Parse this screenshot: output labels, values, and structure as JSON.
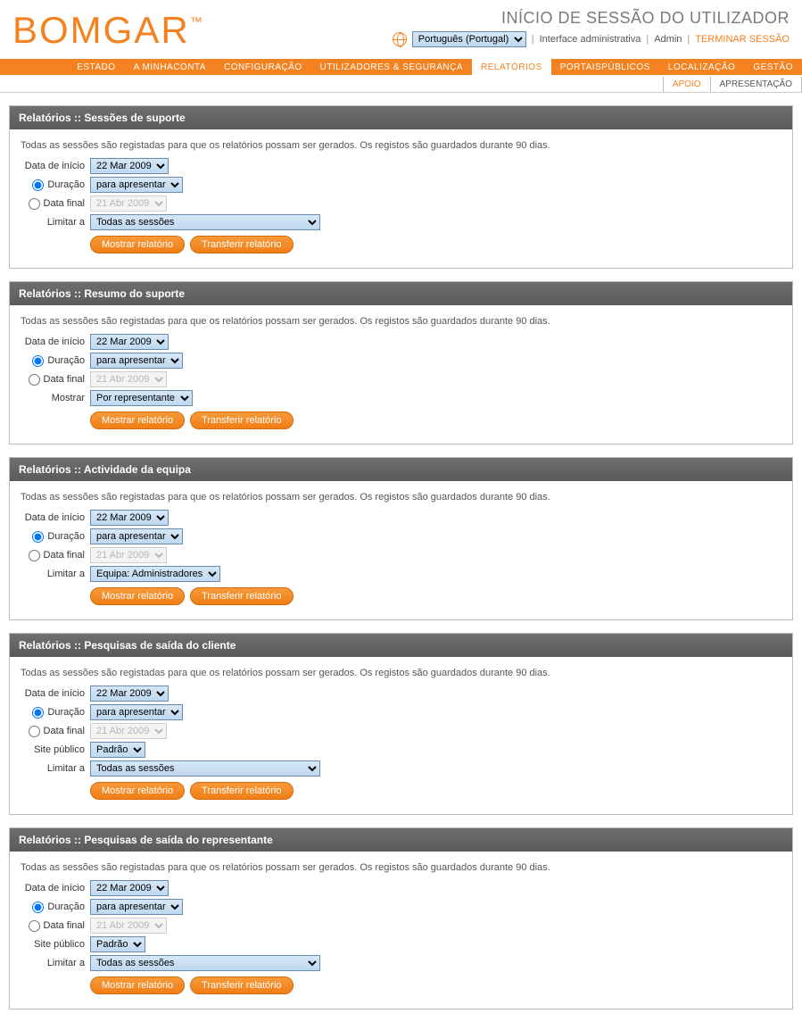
{
  "header": {
    "logo": "BOMGAR",
    "tm": "™",
    "title": "INÍCIO DE SESSÃO DO UTILIZADOR",
    "language": "Português (Portugal)",
    "admin_interface": "Interface administrativa",
    "admin": "Admin",
    "logout": "TERMINAR SESSÃO"
  },
  "nav": {
    "items": [
      "ESTADO",
      "A MINHACONTA",
      "CONFIGURAÇÃO",
      "UTILIZADORES & SEGURANÇA",
      "RELATÓRIOS",
      "PORTAISPÚBLICOS",
      "LOCALIZAÇÃO",
      "GESTÃO"
    ],
    "active": "RELATÓRIOS"
  },
  "subnav": {
    "items": [
      "APOIO",
      "APRESENTAÇÃO"
    ],
    "active": "APOIO"
  },
  "common": {
    "desc": "Todas as sessões são registadas para que os relatórios possam ser gerados. Os registos são guardados durante 90 dias.",
    "start_date_label": "Data de início",
    "start_date_value": "22 Mar 2009",
    "duration_label": "Duração",
    "duration_value": "para apresentar",
    "end_date_label": "Data final",
    "end_date_value": "21 Abr 2009",
    "limit_label": "Limitar a",
    "show_label": "Mostrar",
    "public_site_label": "Site público",
    "public_site_value": "Padrão",
    "show_report_btn": "Mostrar relatório",
    "download_report_btn": "Transferir relatório"
  },
  "panels": {
    "sessions": {
      "title": "Relatórios :: Sessões de suporte",
      "limit_value": "Todas as sessões"
    },
    "summary": {
      "title": "Relatórios :: Resumo do suporte",
      "show_value": "Por representante"
    },
    "team": {
      "title": "Relatórios :: Actividade da equipa",
      "limit_value": "Equipa: Administradores"
    },
    "client_exit": {
      "title": "Relatórios :: Pesquisas de saída do cliente",
      "limit_value": "Todas as sessões"
    },
    "rep_exit": {
      "title": "Relatórios :: Pesquisas de saída do representante",
      "limit_value": "Todas as sessões"
    }
  }
}
